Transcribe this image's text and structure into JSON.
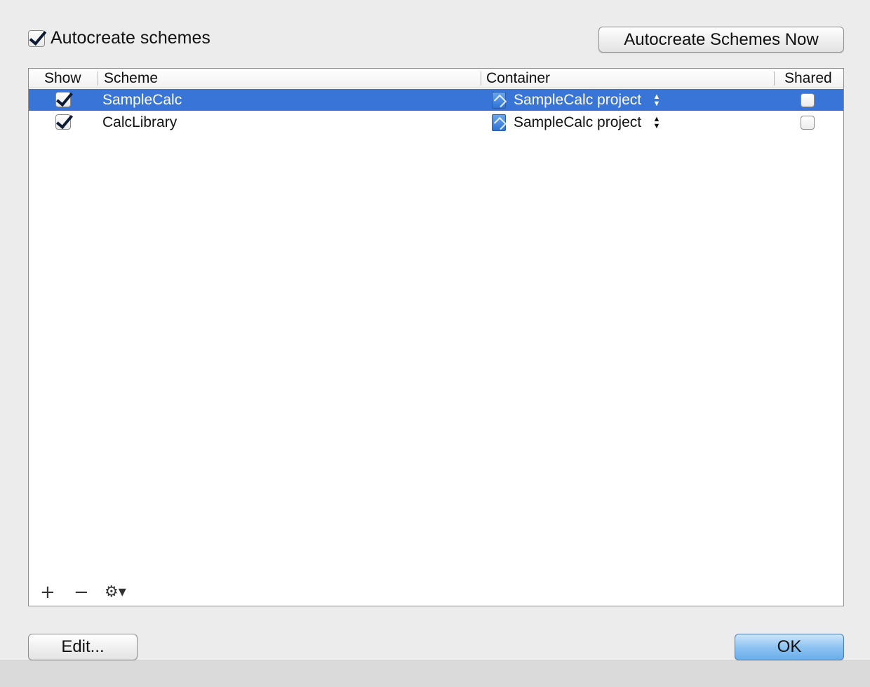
{
  "dialog": {
    "autocreate_label": "Autocreate schemes",
    "autocreate_checked": true,
    "autocreate_now_label": "Autocreate Schemes Now",
    "edit_label": "Edit...",
    "ok_label": "OK"
  },
  "table": {
    "columns": [
      "Show",
      "Scheme",
      "Container",
      "Shared"
    ],
    "rows": [
      {
        "show": true,
        "scheme": "SampleCalc",
        "container": "SampleCalc project",
        "shared": false,
        "selected": true
      },
      {
        "show": true,
        "scheme": "CalcLibrary",
        "container": "SampleCalc project",
        "shared": false,
        "selected": false
      }
    ],
    "actions": {
      "add": "+",
      "remove": "−",
      "gear": "⚙▾"
    }
  },
  "colors": {
    "selection": "#3875d7",
    "ok_button": "#8ec3f1"
  }
}
